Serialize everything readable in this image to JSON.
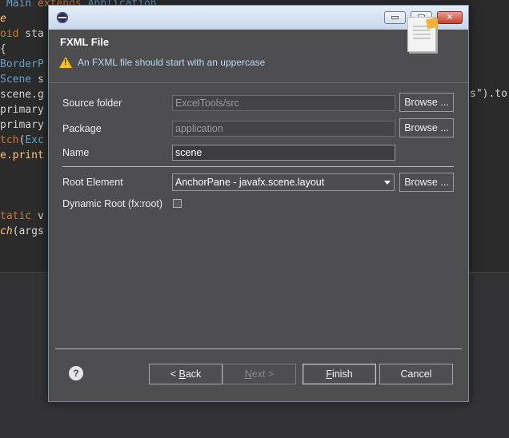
{
  "editor": {
    "lines": [
      {
        "parts": [
          {
            "t": " ",
            "c": "pl"
          },
          {
            "t": "Main",
            "c": "ty"
          },
          {
            "t": " ",
            "c": "pl"
          },
          {
            "t": "extends",
            "c": "kw"
          },
          {
            "t": " ",
            "c": "pl"
          },
          {
            "t": "Application",
            "c": "ty"
          }
        ]
      },
      {
        "parts": [
          {
            "t": "e",
            "c": "it"
          }
        ]
      },
      {
        "parts": [
          {
            "t": "oid",
            "c": "kw"
          },
          {
            "t": " sta",
            "c": "pl"
          }
        ]
      },
      {
        "parts": [
          {
            "t": "{",
            "c": "pl"
          }
        ]
      },
      {
        "parts": [
          {
            "t": "BorderP",
            "c": "ty"
          }
        ]
      },
      {
        "parts": [
          {
            "t": "Scene",
            "c": "ty"
          },
          {
            "t": " s",
            "c": "pl"
          }
        ]
      },
      {
        "parts": [
          {
            "t": "scene.g",
            "c": "pl"
          }
        ]
      },
      {
        "parts": [
          {
            "t": "primary",
            "c": "pl"
          }
        ]
      },
      {
        "parts": [
          {
            "t": "primary",
            "c": "pl"
          }
        ]
      },
      {
        "parts": [
          {
            "t": "tch",
            "c": "kw"
          },
          {
            "t": "(",
            "c": "pl"
          },
          {
            "t": "Exc",
            "c": "ty"
          }
        ]
      },
      {
        "parts": [
          {
            "t": "e.print",
            "c": "fn"
          }
        ]
      },
      {
        "parts": [
          {
            "t": "",
            "c": "pl"
          }
        ]
      },
      {
        "parts": [
          {
            "t": "",
            "c": "pl"
          }
        ]
      },
      {
        "parts": [
          {
            "t": "",
            "c": "pl"
          }
        ]
      },
      {
        "parts": [
          {
            "t": "tatic",
            "c": "kw"
          },
          {
            "t": " v",
            "c": "pl"
          }
        ]
      },
      {
        "parts": [
          {
            "t": "ch",
            "c": "it"
          },
          {
            "t": "(args",
            "c": "pl"
          }
        ]
      }
    ],
    "right_fragment": "s\").to"
  },
  "titlebar": {
    "min_glyph": "▭",
    "max_glyph": "▢",
    "close_glyph": "✕",
    "icon": "eclipse-icon"
  },
  "banner": {
    "title": "FXML File",
    "message": "An FXML file should start with an uppercase",
    "warning_icon": "warning-icon",
    "warning_glyph": "!",
    "doc_icon": "new-file-icon"
  },
  "form": {
    "source_folder_label": "Source folder",
    "source_folder_value": "ExcelTools/src",
    "package_label": "Package",
    "package_value": "application",
    "name_label": "Name",
    "name_value": "scene",
    "browse_label": "Browse ...",
    "root_element_label": "Root Element",
    "root_element_value": "AnchorPane - javafx.scene.layout",
    "dynamic_root_label": "Dynamic Root (fx:root)",
    "dynamic_root_checked": false
  },
  "buttons": {
    "help_glyph": "?",
    "back_pre": "< ",
    "back_accel": "B",
    "back_post": "ack",
    "next_accel": "N",
    "next_post": "ext >",
    "finish_accel": "F",
    "finish_post": "inish",
    "cancel": "Cancel"
  }
}
